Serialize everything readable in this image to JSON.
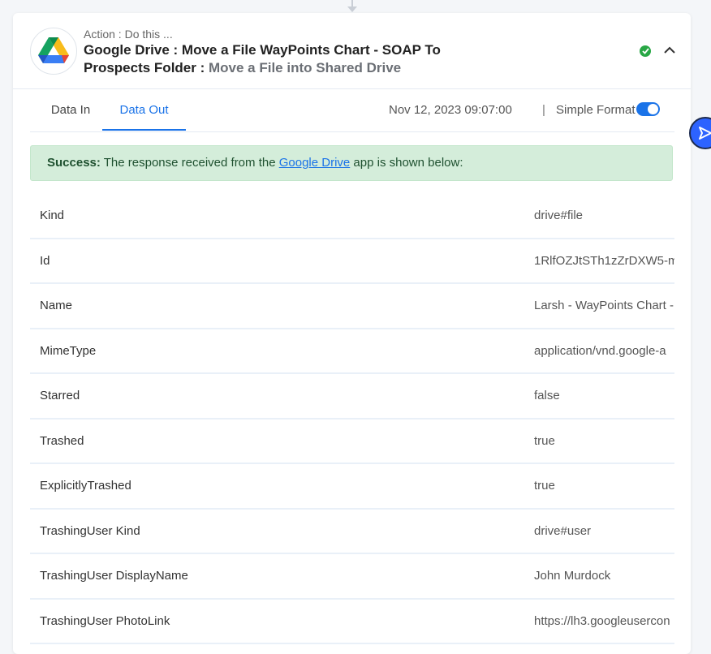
{
  "header": {
    "action_label": "Action : Do this ...",
    "title_main": "Google Drive : Move a File WayPoints Chart - SOAP To Prospects Folder : ",
    "title_sub": "Move a File into Shared Drive",
    "status": "success"
  },
  "tabs": [
    {
      "label": "Data In",
      "active": false
    },
    {
      "label": "Data Out",
      "active": true
    }
  ],
  "meta": {
    "timestamp": "Nov 12, 2023 09:07:00",
    "separator": "|",
    "simple_format_label": "Simple Format",
    "simple_format_on": true
  },
  "alert": {
    "prefix": "Success:",
    "text_before": " The response received from the ",
    "link_text": "Google Drive",
    "text_after": " app is shown below:"
  },
  "rows": [
    {
      "key": "Kind",
      "value": "drive#file"
    },
    {
      "key": "Id",
      "value": "1RlfOZJtSTh1zZrDXW5-m"
    },
    {
      "key": "Name",
      "value": "Larsh - WayPoints Chart - "
    },
    {
      "key": "MimeType",
      "value": "application/vnd.google-a"
    },
    {
      "key": "Starred",
      "value": "false"
    },
    {
      "key": "Trashed",
      "value": "true"
    },
    {
      "key": "ExplicitlyTrashed",
      "value": "true"
    },
    {
      "key": "TrashingUser Kind",
      "value": "drive#user"
    },
    {
      "key": "TrashingUser DisplayName",
      "value": "John Murdock"
    },
    {
      "key": "TrashingUser PhotoLink",
      "value": "https://lh3.googleusercon"
    }
  ],
  "colors": {
    "accent": "#1a73e8",
    "success_bg": "#d4edda",
    "success_icon": "#28a745"
  },
  "icons": {
    "app": "google-drive-icon",
    "status": "check-circle-icon",
    "collapse": "chevron-up-icon",
    "side": "send-icon"
  }
}
